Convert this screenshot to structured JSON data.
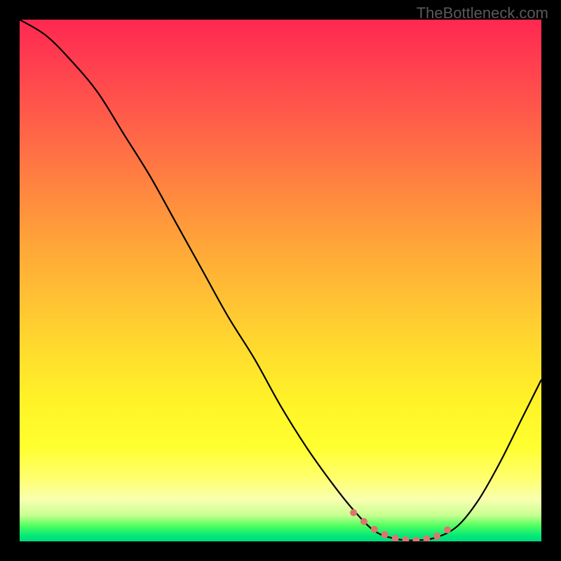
{
  "watermark": "TheBottleneck.com",
  "chart_data": {
    "type": "line",
    "title": "",
    "xlabel": "",
    "ylabel": "",
    "xlim": [
      0,
      100
    ],
    "ylim": [
      0,
      100
    ],
    "series": [
      {
        "name": "bottleneck-curve",
        "x": [
          0,
          5,
          10,
          15,
          20,
          25,
          30,
          35,
          40,
          45,
          50,
          55,
          60,
          64,
          68,
          72,
          76,
          80,
          84,
          88,
          92,
          96,
          100
        ],
        "y": [
          100,
          97,
          92,
          86,
          78,
          70,
          61,
          52,
          43,
          35,
          26,
          18,
          11,
          6,
          2,
          0.5,
          0.2,
          0.8,
          3,
          8,
          15,
          23,
          31
        ]
      }
    ],
    "markers": {
      "name": "highlighted-range",
      "x": [
        64,
        66,
        68,
        70,
        72,
        74,
        76,
        78,
        80,
        82
      ],
      "y": [
        5.5,
        3.8,
        2.3,
        1.3,
        0.6,
        0.3,
        0.2,
        0.5,
        1.0,
        2.2
      ]
    },
    "gradient_bands": [
      {
        "color": "#ff2850",
        "position": 0
      },
      {
        "color": "#ff8440",
        "position": 32
      },
      {
        "color": "#ffe22c",
        "position": 66
      },
      {
        "color": "#ffff30",
        "position": 82
      },
      {
        "color": "#00e878",
        "position": 99
      }
    ]
  }
}
